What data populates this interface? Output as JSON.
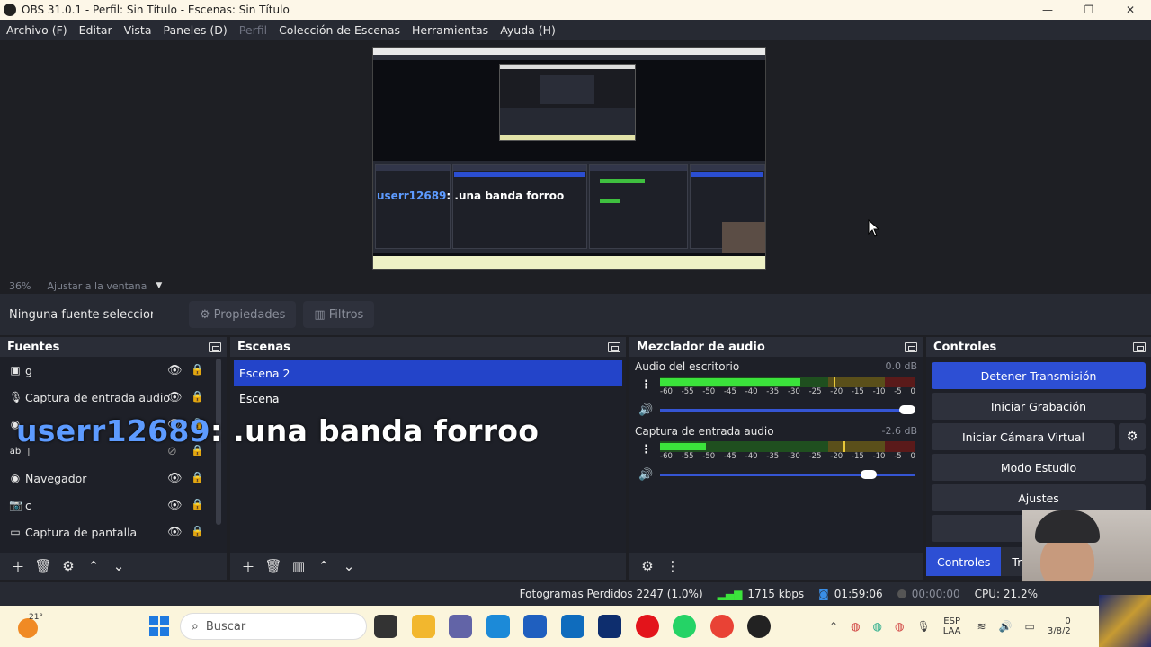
{
  "window": {
    "title": "OBS 31.0.1 - Perfil: Sin Título - Escenas: Sin Título",
    "min": "—",
    "max": "❐",
    "close": "✕"
  },
  "menu": [
    {
      "label": "Archivo (F)"
    },
    {
      "label": "Editar"
    },
    {
      "label": "Vista"
    },
    {
      "label": "Paneles (D)"
    },
    {
      "label": "Perfil",
      "disabled": true
    },
    {
      "label": "Colección de Escenas"
    },
    {
      "label": "Herramientas"
    },
    {
      "label": "Ayuda (H)"
    }
  ],
  "preview": {
    "zoom": "36%",
    "fit_label": "Ajustar a la ventana",
    "inner_overlay_user": "userr12689",
    "inner_overlay_msg": ": .una banda forroo"
  },
  "source_toolbar": {
    "no_source": "Ninguna fuente seleccionada",
    "properties": "Propiedades",
    "filters": "Filtros"
  },
  "sources": {
    "title": "Fuentes",
    "items": [
      {
        "label": "g",
        "icon": "image-icon"
      },
      {
        "label": "Captura de entrada audio",
        "icon": "microphone-icon"
      },
      {
        "label": "",
        "icon": "browser-icon"
      },
      {
        "label": "T",
        "icon": "text-icon"
      },
      {
        "label": "Navegador",
        "icon": "browser-icon"
      },
      {
        "label": "c",
        "icon": "camera-icon"
      },
      {
        "label": "Captura de pantalla",
        "icon": "monitor-icon"
      }
    ]
  },
  "scenes": {
    "title": "Escenas",
    "items": [
      {
        "label": "Escena 2",
        "active": true
      },
      {
        "label": "Escena",
        "active": false
      }
    ]
  },
  "mixer": {
    "title": "Mezclador de audio",
    "ticks": [
      "-60",
      "-55",
      "-50",
      "-45",
      "-40",
      "-35",
      "-30",
      "-25",
      "-20",
      "-15",
      "-10",
      "-5",
      "0"
    ],
    "tracks": [
      {
        "name": "Audio del escritorio",
        "db": "0.0 dB",
        "level": 0.55,
        "peak": 0.68,
        "volume": 1.0
      },
      {
        "name": "Captura de entrada audio",
        "db": "-2.6 dB",
        "level": 0.18,
        "peak": 0.72,
        "volume": 0.84
      }
    ]
  },
  "controls": {
    "title": "Controles",
    "stop_stream": "Detener Transmisión",
    "start_recording": "Iniciar Grabación",
    "start_virtual_cam": "Iniciar Cámara Virtual",
    "studio_mode": "Modo Estudio",
    "settings": "Ajustes",
    "tab_controls": "Controles",
    "tab_transitions": "Tr"
  },
  "status": {
    "dropped_frames": "Fotogramas Perdidos 2247 (1.0%)",
    "bitrate": "1715 kbps",
    "stream_time": "01:59:06",
    "rec_time": "00:00:00",
    "cpu": "CPU: 21.2%"
  },
  "taskbar": {
    "temp": "21°",
    "search_placeholder": "Buscar",
    "lang_top": "ESP",
    "lang_bottom": "LAA",
    "time": "0",
    "date": "3/8/2"
  },
  "chat_overlay": {
    "user": "userr12689",
    "message": ": .una banda forroo"
  },
  "colors": {
    "accent": "#2d4fd4",
    "panel": "#1e2028",
    "meter_green": "#3be33b",
    "meter_yellow": "#e8c83a",
    "meter_red": "#c0302a"
  }
}
